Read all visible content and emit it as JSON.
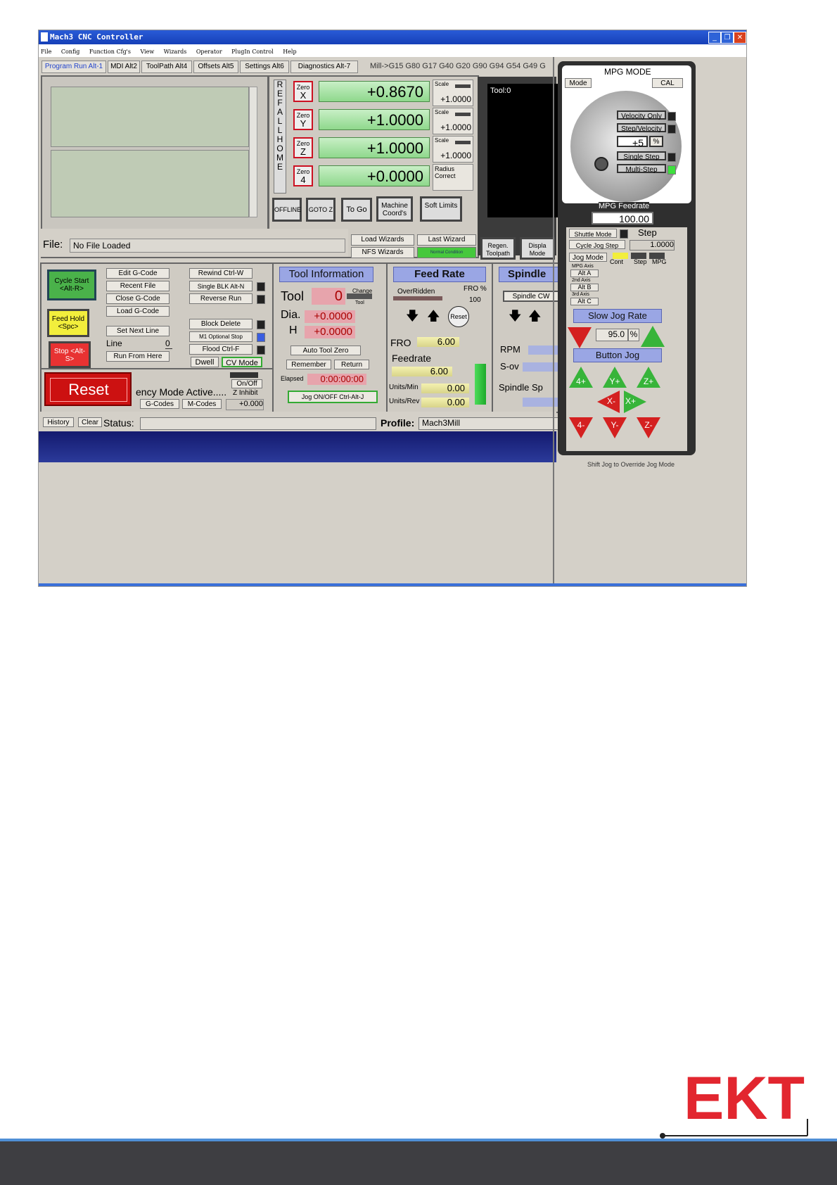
{
  "window": {
    "title": "Mach3 CNC Controller",
    "controls": [
      "_",
      "❐",
      "✕"
    ]
  },
  "menu": [
    "File",
    "Config",
    "Function Cfg's",
    "View",
    "Wizards",
    "Operator",
    "PlugIn Control",
    "Help"
  ],
  "tabs": [
    "Program Run Alt-1",
    "MDI Alt2",
    "ToolPath Alt4",
    "Offsets Alt5",
    "Settings Alt6",
    "Diagnostics Alt-7"
  ],
  "gcode_line": "Mill->G15  G80 G17 G40 G20 G90 G94 G54 G49 G",
  "ref_all_home": [
    "R",
    "E",
    "F",
    "",
    "A",
    "L",
    "L",
    "",
    "H",
    "O",
    "M",
    "E"
  ],
  "axes": [
    {
      "zero_top": "Zero",
      "zero_axis": "X",
      "value": "+0.8670",
      "scale_label": "Scale",
      "scale_value": "+1.0000"
    },
    {
      "zero_top": "Zero",
      "zero_axis": "Y",
      "value": "+1.0000",
      "scale_label": "Scale",
      "scale_value": "+1.0000"
    },
    {
      "zero_top": "Zero",
      "zero_axis": "Z",
      "value": "+1.0000",
      "scale_label": "Scale",
      "scale_value": "+1.0000"
    },
    {
      "zero_top": "Zero",
      "zero_axis": "4",
      "value": "+0.0000",
      "scale_label": "Radius Correct",
      "scale_value": ""
    }
  ],
  "dro_buttons": [
    "OFFLINE",
    "GOTO Z",
    "To Go",
    "Machine Coord's",
    "Soft Limits"
  ],
  "toolpath": {
    "label": "Tool:0"
  },
  "file": {
    "label": "File:",
    "value": "No File Loaded"
  },
  "wizards": {
    "load": "Load Wizards",
    "last": "Last Wizard",
    "nfs": "NFS Wizards",
    "normal": "Normal Condition"
  },
  "regen": {
    "regen": "Regen. Toolpath",
    "display": "Displa Mode"
  },
  "program": {
    "cycle_start": "Cycle Start <Alt-R>",
    "feed_hold": "Feed Hold <Spc>",
    "stop": "Stop <Alt-S>",
    "edit": "Edit G-Code",
    "recent": "Recent File",
    "close": "Close G-Code",
    "load": "Load G-Code",
    "set_next": "Set Next Line",
    "line_label": "Line",
    "line_value": "0",
    "run_from": "Run From Here",
    "rewind": "Rewind Ctrl-W",
    "single_blk": "Single BLK Alt-N",
    "reverse": "Reverse Run",
    "block_delete": "Block Delete",
    "m1": "M1 Optional Stop",
    "flood": "Flood Ctrl-F",
    "dwell": "Dwell",
    "cv_mode": "CV Mode",
    "reset": "Reset",
    "emergency": "ency Mode Active.....",
    "onoff": "On/Off",
    "z_inhibit": "Z Inhibit",
    "z_value": "+0.000",
    "gcodes": "G-Codes",
    "mcodes": "M-Codes"
  },
  "tool_info": {
    "header": "Tool Information",
    "tool_label": "Tool",
    "tool_value": "0",
    "change": "Change",
    "tool_small": "Tool",
    "dia_label": "Dia.",
    "dia_value": "+0.0000",
    "h_label": "H",
    "h_value": "+0.0000",
    "auto_zero": "Auto Tool Zero",
    "remember": "Remember",
    "return": "Return",
    "elapsed_label": "Elapsed",
    "elapsed_value": "0:00:00:00",
    "jog_onoff": "Jog ON/OFF Ctrl-Alt-J"
  },
  "feed_rate": {
    "header": "Feed Rate",
    "overridden": "OverRidden",
    "fro_pct": "FRO %",
    "fro_pct_value": "100",
    "reset": "Reset",
    "fro_label": "FRO",
    "fro_value": "6.00",
    "feedrate_label": "Feedrate",
    "feedrate_value": "6.00",
    "units_min": "Units/Min",
    "units_min_value": "0.00",
    "units_rev": "Units/Rev",
    "units_rev_value": "0.00"
  },
  "spindle": {
    "header": "Spindle",
    "cw": "Spindle CW",
    "rpm": "RPM",
    "sov": "S-ov",
    "speed": "Spindle Sp"
  },
  "status": {
    "history": "History",
    "clear": "Clear",
    "label": "Status:",
    "profile_label": "Profile:",
    "profile_value": "Mach3Mill"
  },
  "mpg": {
    "title": "MPG MODE",
    "mode": "Mode",
    "cal": "CAL",
    "velocity": "Velocity Only",
    "step_vel": "Step/Velocity",
    "step_value": "+5",
    "pct": "%",
    "single": "Single Step",
    "multi": "Multi-Step",
    "feedrate_label": "MPG Feedrate",
    "feedrate_value": "100.00",
    "shuttle": "Shuttle Mode",
    "step_label": "Step",
    "cycle_jog": "Cycle Jog Step",
    "cycle_jog_value": "1.0000",
    "jog_mode": "Jog Mode",
    "cont": "Cont",
    "step_col": "Step",
    "mpg_col": "MPG",
    "mpg_axis": "MPG Axis",
    "alt_a": "Alt A",
    "axis2": "2nd Axis",
    "alt_b": "Alt B",
    "axis3": "3rd Axis",
    "alt_c": "Alt C",
    "slow_jog": "Slow Jog Rate",
    "slow_value": "95.0",
    "button_jog": "Button Jog",
    "jog_up": [
      "4+",
      "Y+",
      "Z+"
    ],
    "jog_mid": [
      "X-",
      "X+"
    ],
    "jog_down": [
      "4-",
      "Y-",
      "Z-"
    ],
    "footer": "Shift Jog to Override Jog Mode"
  },
  "logo": {
    "text": "EKT"
  },
  "colors": {
    "titlebar": "#1f4fc9",
    "dro_green": "#9ee09b",
    "panel_bg": "#d4d0c8",
    "header_blue": "#9aa6e4",
    "logo_red": "#e2262f",
    "footer_bar": "#3e3e42"
  }
}
